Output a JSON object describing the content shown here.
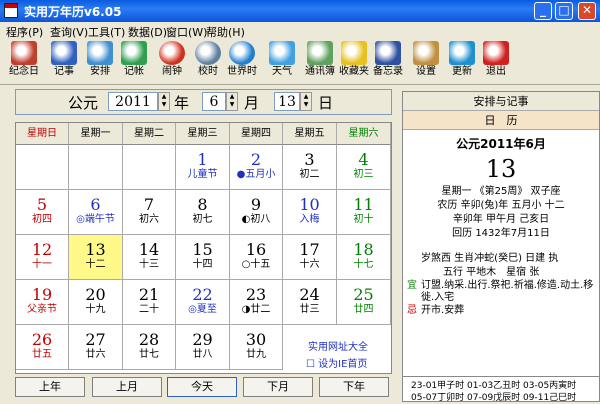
{
  "window": {
    "title": "实用万年历v6.05",
    "min": "_",
    "max": "□",
    "close": "✕"
  },
  "menu": [
    "程序(P)",
    "查询(V)",
    "工具(T)",
    "数据(D)",
    "窗口(W)",
    "帮助(H)"
  ],
  "toolbar": [
    {
      "label": "纪念日",
      "icon": "anniversary-icon",
      "color": "#c04030"
    },
    {
      "label": "记事",
      "icon": "notebook-icon",
      "color": "#3060c0"
    },
    {
      "label": "安排",
      "icon": "schedule-icon",
      "color": "#4090d0"
    },
    {
      "label": "记帐",
      "icon": "ledger-icon",
      "color": "#30a050"
    },
    {
      "label": "闹钟",
      "icon": "alarm-clock-icon",
      "color": "#d03020"
    },
    {
      "label": "校时",
      "icon": "clock-sync-icon",
      "color": "#6080a0"
    },
    {
      "label": "世界时",
      "icon": "globe-icon",
      "color": "#2080d0"
    },
    {
      "label": "天气",
      "icon": "weather-icon",
      "color": "#40a0e0"
    },
    {
      "label": "通讯簿",
      "icon": "address-book-icon",
      "color": "#60a060"
    },
    {
      "label": "收藏夹",
      "icon": "star-icon",
      "color": "#e8c020"
    },
    {
      "label": "备忘录",
      "icon": "memo-icon",
      "color": "#3050a0"
    },
    {
      "label": "设置",
      "icon": "settings-icon",
      "color": "#c09040"
    },
    {
      "label": "更新",
      "icon": "update-icon",
      "color": "#2090d0"
    },
    {
      "label": "退出",
      "icon": "exit-icon",
      "color": "#d02020"
    }
  ],
  "datebar": {
    "era": "公元",
    "year": "2011",
    "year_unit": "年",
    "month": "6",
    "month_unit": "月",
    "day": "13",
    "day_unit": "日"
  },
  "weekdays": [
    "星期日",
    "星期一",
    "星期二",
    "星期三",
    "星期四",
    "星期五",
    "星期六"
  ],
  "weekday_colors": [
    "#c00000",
    "#000000",
    "#000000",
    "#000000",
    "#000000",
    "#000000",
    "#008000"
  ],
  "weeks": [
    [
      null,
      null,
      null,
      {
        "d": "1",
        "l": "儿童节"
      },
      {
        "d": "2",
        "l": "●五月小"
      },
      {
        "d": "3",
        "l": "初二"
      },
      {
        "d": "4",
        "l": "初三"
      }
    ],
    [
      {
        "d": "5",
        "l": "初四"
      },
      {
        "d": "6",
        "l": "◎端午节"
      },
      {
        "d": "7",
        "l": "初六"
      },
      {
        "d": "8",
        "l": "初七"
      },
      {
        "d": "9",
        "l": "◐初八"
      },
      {
        "d": "10",
        "l": "入梅"
      },
      {
        "d": "11",
        "l": "初十"
      }
    ],
    [
      {
        "d": "12",
        "l": "十一"
      },
      {
        "d": "13",
        "l": "十二"
      },
      {
        "d": "14",
        "l": "十三"
      },
      {
        "d": "15",
        "l": "十四"
      },
      {
        "d": "16",
        "l": "○十五"
      },
      {
        "d": "17",
        "l": "十六"
      },
      {
        "d": "18",
        "l": "十七"
      }
    ],
    [
      {
        "d": "19",
        "l": "父亲节"
      },
      {
        "d": "20",
        "l": "十九"
      },
      {
        "d": "21",
        "l": "二十"
      },
      {
        "d": "22",
        "l": "◎夏至"
      },
      {
        "d": "23",
        "l": "◑廿二"
      },
      {
        "d": "24",
        "l": "廿三"
      },
      {
        "d": "25",
        "l": "廿四"
      }
    ],
    [
      {
        "d": "26",
        "l": "廿五"
      },
      {
        "d": "27",
        "l": "廿六"
      },
      {
        "d": "28",
        "l": "廿七"
      },
      {
        "d": "29",
        "l": "廿八"
      },
      {
        "d": "30",
        "l": "廿九"
      },
      null,
      null
    ]
  ],
  "extras": {
    "site_link": "实用网址大全",
    "homepage": "设为IE首页"
  },
  "nav": [
    "上年",
    "上月",
    "今天",
    "下月",
    "下年"
  ],
  "right": {
    "tab1": "安排与记事",
    "tab2": "日　历",
    "heading": "公元2011年6月",
    "day": "13",
    "line1": "星期一 《第25周》 双子座",
    "line2": "农历 辛卯(兔)年 五月小 十二",
    "line3": "辛卯年 甲午月 己亥日",
    "line4": "回历 1432年7月11日",
    "info1": "岁煞西 生肖冲蛇(癸巳) 日建 执",
    "info2": "五行 平地木　星宿 张",
    "yi_mark": "宜",
    "yi": "订盟.纳采.出行.祭祀.祈福.修造.动土.移徙.入宅",
    "ji_mark": "忌",
    "ji": "开市.安葬",
    "hours1": "23-01甲子时 01-03乙丑时 03-05丙寅时",
    "hours2": "05-07丁卯时 07-09戊辰时 09-11己巳时"
  },
  "colors": {
    "red": "#c00000",
    "green": "#008000",
    "blue": "#2030c0",
    "selected_bg": "#fff98a"
  }
}
